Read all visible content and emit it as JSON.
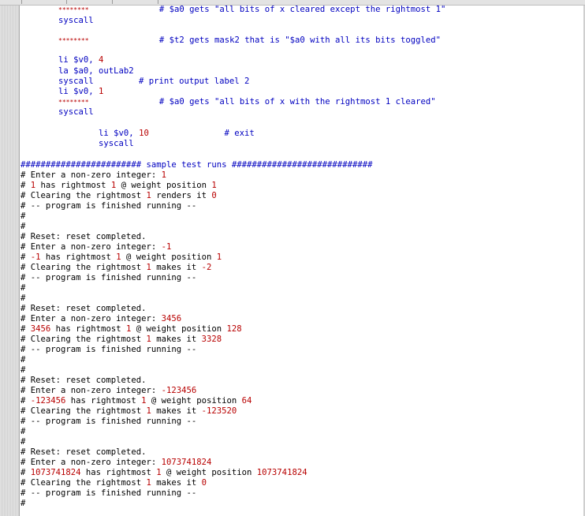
{
  "colors": {
    "keyword": "#0000c0",
    "number": "#b80000",
    "comment": "#000000",
    "background": "#ffffff",
    "gutter": "#d9d9d9"
  },
  "editor": {
    "lines": [
      {
        "parts": [
          [
            "stars",
            "********"
          ],
          [
            "blue",
            "              # $a0 gets \"all bits of x cleared except the rightmost 1\""
          ]
        ]
      },
      {
        "parts": [
          [
            "blue",
            "syscall"
          ]
        ]
      },
      {
        "parts": []
      },
      {
        "parts": [
          [
            "stars",
            "********"
          ],
          [
            "blue",
            "              # $t2 gets mask2 that is \"$a0 with all its bits toggled\""
          ]
        ]
      },
      {
        "parts": []
      },
      {
        "parts": []
      },
      {
        "parts": [
          [
            "blue",
            "li $v0, "
          ],
          [
            "red",
            "4"
          ]
        ]
      },
      {
        "parts": [
          [
            "blue",
            "la $a0, outLab2"
          ]
        ]
      },
      {
        "parts": [
          [
            "blue",
            "syscall         # print output label 2"
          ]
        ]
      },
      {
        "parts": [
          [
            "blue",
            "li $v0, "
          ],
          [
            "red",
            "1"
          ]
        ]
      },
      {
        "parts": [
          [
            "stars",
            "********"
          ],
          [
            "blue",
            "              # $a0 gets \"all bits of x with the rightmost 1 cleared\""
          ]
        ]
      },
      {
        "parts": [
          [
            "blue",
            "syscall"
          ]
        ]
      },
      {
        "parts": []
      },
      {
        "parts": [
          [
            "blue",
            "        li $v0, "
          ],
          [
            "red",
            "10"
          ],
          [
            "blue",
            "               # exit"
          ]
        ]
      },
      {
        "parts": [
          [
            "blue",
            "        syscall"
          ]
        ]
      },
      {
        "parts": []
      },
      {
        "parts": [
          [
            "blue",
            "######################## sample test runs ############################"
          ]
        ]
      },
      {
        "parts": [
          [
            "black",
            "# Enter a non-zero integer: "
          ],
          [
            "red",
            "1"
          ]
        ]
      },
      {
        "parts": [
          [
            "black",
            "# "
          ],
          [
            "red",
            "1"
          ],
          [
            "black",
            " has rightmost "
          ],
          [
            "red",
            "1"
          ],
          [
            "black",
            " @ weight position "
          ],
          [
            "red",
            "1"
          ]
        ]
      },
      {
        "parts": [
          [
            "black",
            "# Clearing the rightmost "
          ],
          [
            "red",
            "1"
          ],
          [
            "black",
            " renders it "
          ],
          [
            "red",
            "0"
          ]
        ]
      },
      {
        "parts": [
          [
            "black",
            "# -- program is finished running --"
          ]
        ]
      },
      {
        "parts": [
          [
            "black",
            "#"
          ]
        ]
      },
      {
        "parts": [
          [
            "black",
            "#"
          ]
        ]
      },
      {
        "parts": [
          [
            "black",
            "# Reset: reset completed."
          ]
        ]
      },
      {
        "parts": [
          [
            "black",
            "# Enter a non-zero integer: "
          ],
          [
            "red",
            "-1"
          ]
        ]
      },
      {
        "parts": [
          [
            "black",
            "# "
          ],
          [
            "red",
            "-1"
          ],
          [
            "black",
            " has rightmost "
          ],
          [
            "red",
            "1"
          ],
          [
            "black",
            " @ weight position "
          ],
          [
            "red",
            "1"
          ]
        ]
      },
      {
        "parts": [
          [
            "black",
            "# Clearing the rightmost "
          ],
          [
            "red",
            "1"
          ],
          [
            "black",
            " makes it "
          ],
          [
            "red",
            "-2"
          ]
        ]
      },
      {
        "parts": [
          [
            "black",
            "# -- program is finished running --"
          ]
        ]
      },
      {
        "parts": [
          [
            "black",
            "#"
          ]
        ]
      },
      {
        "parts": [
          [
            "black",
            "#"
          ]
        ]
      },
      {
        "parts": [
          [
            "black",
            "# Reset: reset completed."
          ]
        ]
      },
      {
        "parts": [
          [
            "black",
            "# Enter a non-zero integer: "
          ],
          [
            "red",
            "3456"
          ]
        ]
      },
      {
        "parts": [
          [
            "black",
            "# "
          ],
          [
            "red",
            "3456"
          ],
          [
            "black",
            " has rightmost "
          ],
          [
            "red",
            "1"
          ],
          [
            "black",
            " @ weight position "
          ],
          [
            "red",
            "128"
          ]
        ]
      },
      {
        "parts": [
          [
            "black",
            "# Clearing the rightmost "
          ],
          [
            "red",
            "1"
          ],
          [
            "black",
            " makes it "
          ],
          [
            "red",
            "3328"
          ]
        ]
      },
      {
        "parts": [
          [
            "black",
            "# -- program is finished running --"
          ]
        ]
      },
      {
        "parts": [
          [
            "black",
            "#"
          ]
        ]
      },
      {
        "parts": [
          [
            "black",
            "#"
          ]
        ]
      },
      {
        "parts": [
          [
            "black",
            "# Reset: reset completed."
          ]
        ]
      },
      {
        "parts": [
          [
            "black",
            "# Enter a non-zero integer: "
          ],
          [
            "red",
            "-123456"
          ]
        ]
      },
      {
        "parts": [
          [
            "black",
            "# "
          ],
          [
            "red",
            "-123456"
          ],
          [
            "black",
            " has rightmost "
          ],
          [
            "red",
            "1"
          ],
          [
            "black",
            " @ weight position "
          ],
          [
            "red",
            "64"
          ]
        ]
      },
      {
        "parts": [
          [
            "black",
            "# Clearing the rightmost "
          ],
          [
            "red",
            "1"
          ],
          [
            "black",
            " makes it "
          ],
          [
            "red",
            "-123520"
          ]
        ]
      },
      {
        "parts": [
          [
            "black",
            "# -- program is finished running --"
          ]
        ]
      },
      {
        "parts": [
          [
            "black",
            "#"
          ]
        ]
      },
      {
        "parts": [
          [
            "black",
            "#"
          ]
        ]
      },
      {
        "parts": [
          [
            "black",
            "# Reset: reset completed."
          ]
        ]
      },
      {
        "parts": [
          [
            "black",
            "# Enter a non-zero integer: "
          ],
          [
            "red",
            "1073741824"
          ]
        ]
      },
      {
        "parts": [
          [
            "black",
            "# "
          ],
          [
            "red",
            "1073741824"
          ],
          [
            "black",
            " has rightmost "
          ],
          [
            "red",
            "1"
          ],
          [
            "black",
            " @ weight position "
          ],
          [
            "red",
            "1073741824"
          ]
        ]
      },
      {
        "parts": [
          [
            "black",
            "# Clearing the rightmost "
          ],
          [
            "red",
            "1"
          ],
          [
            "black",
            " makes it "
          ],
          [
            "red",
            "0"
          ]
        ]
      },
      {
        "parts": [
          [
            "black",
            "# -- program is finished running --"
          ]
        ]
      },
      {
        "parts": [
          [
            "black",
            "#"
          ]
        ]
      }
    ]
  }
}
